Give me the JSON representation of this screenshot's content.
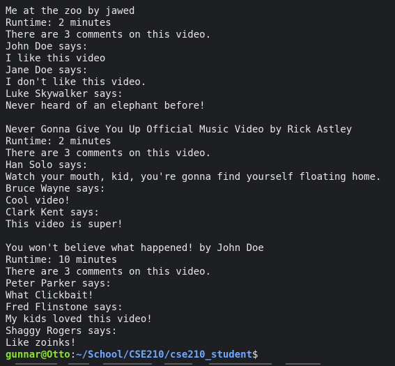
{
  "terminal": {
    "lines": [
      "Me at the zoo by jawed",
      "Runtime: 2 minutes",
      "There are 3 comments on this video.",
      "John Doe says:",
      "I like this video",
      "Jane Doe says:",
      "I don't like this video.",
      "Luke Skywalker says:",
      "Never heard of an elephant before!",
      "",
      "Never Gonna Give You Up Official Music Video by Rick Astley",
      "Runtime: 2 minutes",
      "There are 3 comments on this video.",
      "Han Solo says:",
      "Watch your mouth, kid, you're gonna find yourself floating home.",
      "Bruce Wayne says:",
      "Cool video!",
      "Clark Kent says:",
      "This video is super!",
      "",
      "You won't believe what happened! by John Doe",
      "Runtime: 10 minutes",
      "There are 3 comments on this video.",
      "Peter Parker says:",
      "What Clickbait!",
      "Fred Flinstone says:",
      "My kids loved this video!",
      "Shaggy Rogers says:",
      "Like zoinks!"
    ],
    "prompt": {
      "user_host": "gunnar@Otto",
      "separator": ":",
      "path": "~/School/CSE210/cse210_student",
      "symbol": "$"
    }
  }
}
